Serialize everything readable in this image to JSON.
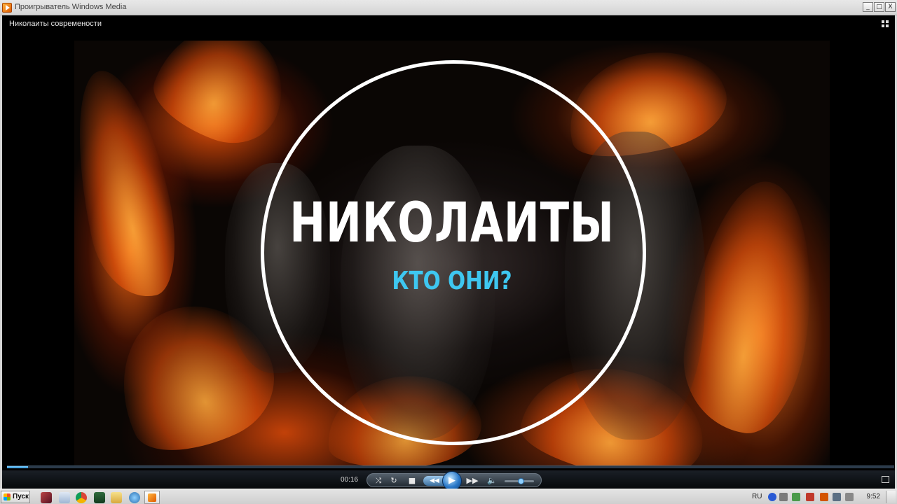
{
  "window": {
    "title": "Проигрыватель Windows Media",
    "minimize_glyph": "_",
    "maximize_glyph": "□",
    "close_glyph": "X"
  },
  "player": {
    "media_title": "Николаиты современости",
    "video_headline": "НИКОЛАИТЫ",
    "video_subtitle": "КТО ОНИ?",
    "progress_fraction": 0.024,
    "current_time": "00:16",
    "volume_fraction": 0.55,
    "accent_color": "#3ec7f0"
  },
  "controls": {
    "shuffle_glyph": "⤨",
    "repeat_glyph": "↻",
    "stop_glyph": "■",
    "prev_glyph": "◀◀",
    "play_glyph": "▶",
    "next_glyph": "▶▶",
    "volume_glyph": "🔈"
  },
  "taskbar": {
    "start_label": "Пуск",
    "language": "RU",
    "clock": "9:52"
  }
}
